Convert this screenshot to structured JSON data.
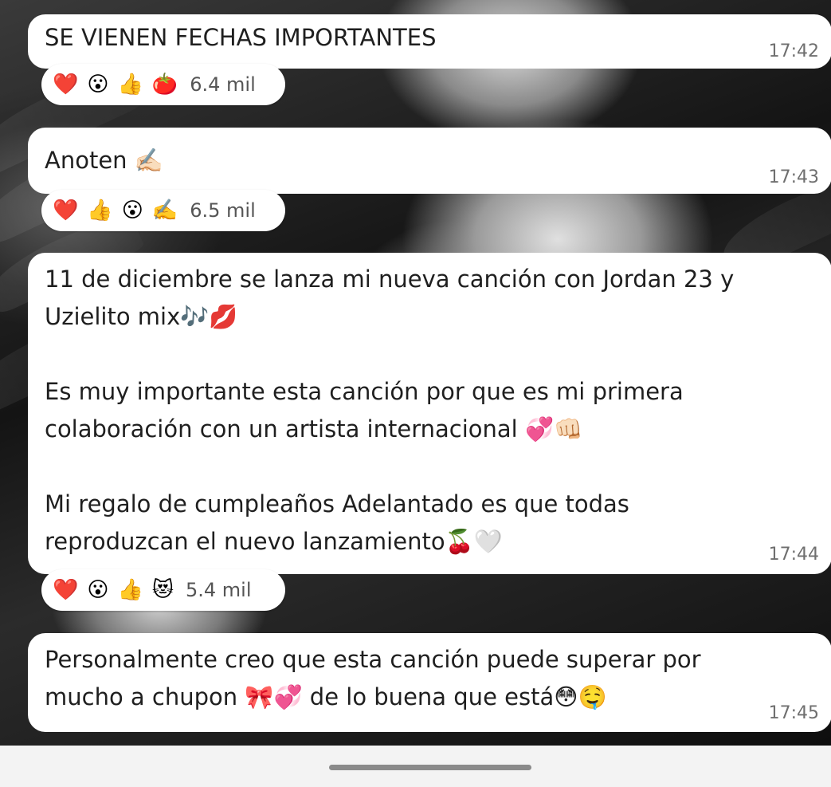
{
  "messages": [
    {
      "text": "SE VIENEN FECHAS IMPORTANTES",
      "time": "17:42",
      "reactions": {
        "emojis": [
          "❤️",
          "😮",
          "👍",
          "🍅"
        ],
        "count": "6.4 mil"
      }
    },
    {
      "text": "Anoten ✍🏻",
      "time": "17:43",
      "reactions": {
        "emojis": [
          "❤️",
          "👍",
          "😮",
          "✍️"
        ],
        "count": "6.5 mil"
      }
    },
    {
      "text": "11 de diciembre se lanza mi nueva canción con Jordan 23 y\nUzielito mix🎶💋\n\nEs muy importante esta canción por que es mi primera\ncolaboración con un artista internacional 💞👊🏻\n\nMi regalo de cumpleaños Adelantado es que todas\nreproduzcan el nuevo lanzamiento🍒🤍",
      "time": "17:44",
      "reactions": {
        "emojis": [
          "❤️",
          "😮",
          "👍",
          "😻"
        ],
        "count": "5.4 mil"
      }
    },
    {
      "text": "Personalmente creo que esta canción puede superar por\nmucho a chupon 🎀💞 de lo buena que está😳🤤",
      "time": "17:45"
    }
  ],
  "icons": {
    "nav_handle": "gesture-bar"
  }
}
